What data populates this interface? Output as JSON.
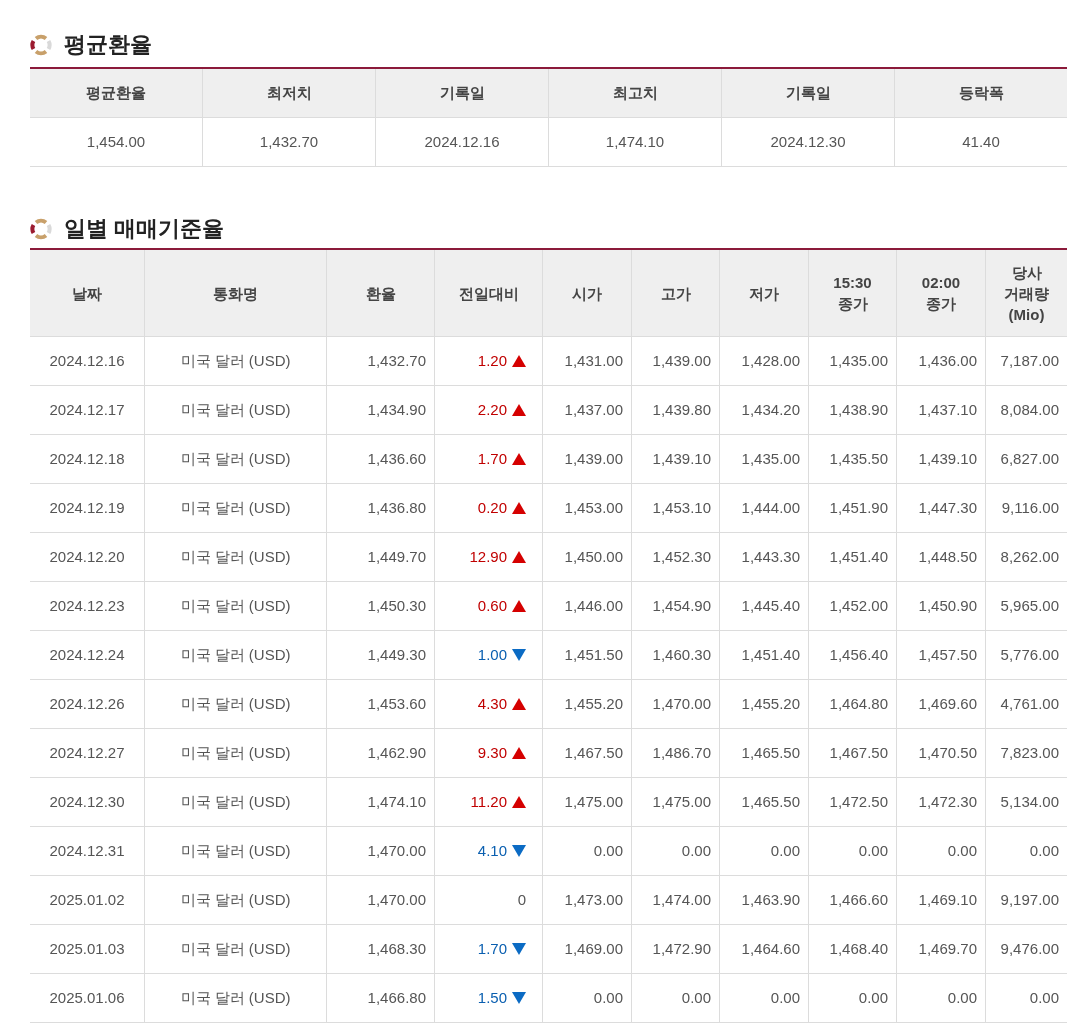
{
  "average_section": {
    "title": "평균환율",
    "columns": [
      "평균환율",
      "최저치",
      "기록일",
      "최고치",
      "기록일",
      "등락폭"
    ],
    "row": [
      "1,454.00",
      "1,432.70",
      "2024.12.16",
      "1,474.10",
      "2024.12.30",
      "41.40"
    ]
  },
  "daily_section": {
    "title": "일별 매매기준율",
    "columns": [
      [
        "날짜"
      ],
      [
        "통화명"
      ],
      [
        "환율"
      ],
      [
        "전일대비"
      ],
      [
        "시가"
      ],
      [
        "고가"
      ],
      [
        "저가"
      ],
      [
        "15:30",
        "종가"
      ],
      [
        "02:00",
        "종가"
      ],
      [
        "당사",
        "거래량",
        "(Mio)"
      ]
    ],
    "rows": [
      {
        "date": "2024.12.16",
        "currency": "미국 달러 (USD)",
        "rate": "1,432.70",
        "change": "1.20",
        "kind": "up",
        "open": "1,431.00",
        "high": "1,439.00",
        "low": "1,428.00",
        "close_1530": "1,435.00",
        "close_0200": "1,436.00",
        "volume": "7,187.00"
      },
      {
        "date": "2024.12.17",
        "currency": "미국 달러 (USD)",
        "rate": "1,434.90",
        "change": "2.20",
        "kind": "up",
        "open": "1,437.00",
        "high": "1,439.80",
        "low": "1,434.20",
        "close_1530": "1,438.90",
        "close_0200": "1,437.10",
        "volume": "8,084.00"
      },
      {
        "date": "2024.12.18",
        "currency": "미국 달러 (USD)",
        "rate": "1,436.60",
        "change": "1.70",
        "kind": "up",
        "open": "1,439.00",
        "high": "1,439.10",
        "low": "1,435.00",
        "close_1530": "1,435.50",
        "close_0200": "1,439.10",
        "volume": "6,827.00"
      },
      {
        "date": "2024.12.19",
        "currency": "미국 달러 (USD)",
        "rate": "1,436.80",
        "change": "0.20",
        "kind": "up",
        "open": "1,453.00",
        "high": "1,453.10",
        "low": "1,444.00",
        "close_1530": "1,451.90",
        "close_0200": "1,447.30",
        "volume": "9,116.00"
      },
      {
        "date": "2024.12.20",
        "currency": "미국 달러 (USD)",
        "rate": "1,449.70",
        "change": "12.90",
        "kind": "up",
        "open": "1,450.00",
        "high": "1,452.30",
        "low": "1,443.30",
        "close_1530": "1,451.40",
        "close_0200": "1,448.50",
        "volume": "8,262.00"
      },
      {
        "date": "2024.12.23",
        "currency": "미국 달러 (USD)",
        "rate": "1,450.30",
        "change": "0.60",
        "kind": "up",
        "open": "1,446.00",
        "high": "1,454.90",
        "low": "1,445.40",
        "close_1530": "1,452.00",
        "close_0200": "1,450.90",
        "volume": "5,965.00"
      },
      {
        "date": "2024.12.24",
        "currency": "미국 달러 (USD)",
        "rate": "1,449.30",
        "change": "1.00",
        "kind": "down",
        "open": "1,451.50",
        "high": "1,460.30",
        "low": "1,451.40",
        "close_1530": "1,456.40",
        "close_0200": "1,457.50",
        "volume": "5,776.00"
      },
      {
        "date": "2024.12.26",
        "currency": "미국 달러 (USD)",
        "rate": "1,453.60",
        "change": "4.30",
        "kind": "up",
        "open": "1,455.20",
        "high": "1,470.00",
        "low": "1,455.20",
        "close_1530": "1,464.80",
        "close_0200": "1,469.60",
        "volume": "4,761.00"
      },
      {
        "date": "2024.12.27",
        "currency": "미국 달러 (USD)",
        "rate": "1,462.90",
        "change": "9.30",
        "kind": "up",
        "open": "1,467.50",
        "high": "1,486.70",
        "low": "1,465.50",
        "close_1530": "1,467.50",
        "close_0200": "1,470.50",
        "volume": "7,823.00"
      },
      {
        "date": "2024.12.30",
        "currency": "미국 달러 (USD)",
        "rate": "1,474.10",
        "change": "11.20",
        "kind": "up",
        "open": "1,475.00",
        "high": "1,475.00",
        "low": "1,465.50",
        "close_1530": "1,472.50",
        "close_0200": "1,472.30",
        "volume": "5,134.00"
      },
      {
        "date": "2024.12.31",
        "currency": "미국 달러 (USD)",
        "rate": "1,470.00",
        "change": "4.10",
        "kind": "down",
        "open": "0.00",
        "high": "0.00",
        "low": "0.00",
        "close_1530": "0.00",
        "close_0200": "0.00",
        "volume": "0.00"
      },
      {
        "date": "2025.01.02",
        "currency": "미국 달러 (USD)",
        "rate": "1,470.00",
        "change": "0",
        "kind": "none",
        "open": "1,473.00",
        "high": "1,474.00",
        "low": "1,463.90",
        "close_1530": "1,466.60",
        "close_0200": "1,469.10",
        "volume": "9,197.00"
      },
      {
        "date": "2025.01.03",
        "currency": "미국 달러 (USD)",
        "rate": "1,468.30",
        "change": "1.70",
        "kind": "down",
        "open": "1,469.00",
        "high": "1,472.90",
        "low": "1,464.60",
        "close_1530": "1,468.40",
        "close_0200": "1,469.70",
        "volume": "9,476.00"
      },
      {
        "date": "2025.01.06",
        "currency": "미국 달러 (USD)",
        "rate": "1,466.80",
        "change": "1.50",
        "kind": "down",
        "open": "0.00",
        "high": "0.00",
        "low": "0.00",
        "close_1530": "0.00",
        "close_0200": "0.00",
        "volume": "0.00"
      }
    ]
  }
}
